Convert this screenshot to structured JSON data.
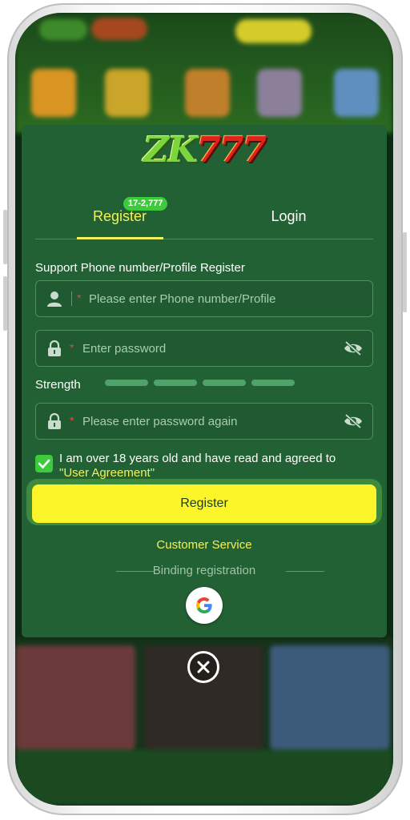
{
  "logo": {
    "part1": "ZK",
    "part2": "777"
  },
  "tabs": {
    "register": "Register",
    "login": "Login",
    "badge": "17-2,777"
  },
  "form": {
    "support_label": "Support Phone number/Profile Register",
    "required_mark": "*",
    "phone_placeholder": "Please enter Phone number/Profile",
    "password_placeholder": "Enter password",
    "strength_label": "Strength",
    "confirm_placeholder": "Please enter password again",
    "agreement_text": "I am over 18 years old and have read and agreed to",
    "agreement_link": "\"User Agreement\"",
    "agreement_checked": true,
    "register_button": "Register",
    "customer_service": "Customer Service",
    "binding_label": "Binding registration"
  },
  "icons": {
    "user": "user-icon",
    "lock": "lock-icon",
    "eye": "eye-off-icon",
    "check": "check-icon",
    "google": "google-icon",
    "close": "close-icon"
  },
  "colors": {
    "panel": "#226134",
    "accent_yellow": "#f3f15a",
    "button": "#fbf52a",
    "check": "#3dcb3d"
  }
}
